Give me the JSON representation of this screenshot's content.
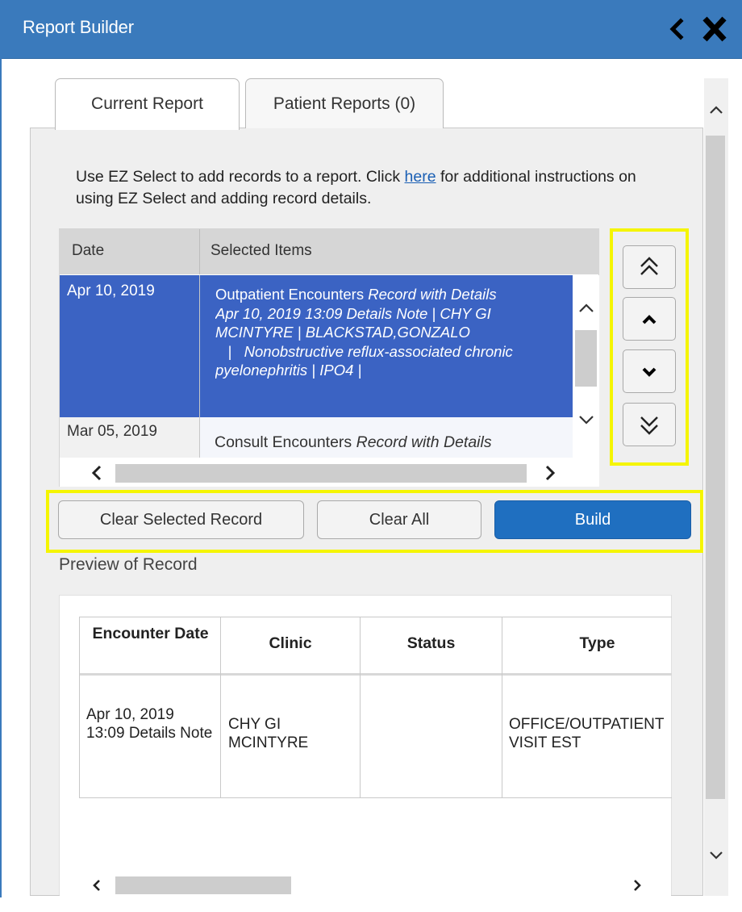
{
  "window": {
    "title": "Report Builder",
    "collapse_icon": "chevron-left-icon",
    "close_icon": "close-icon",
    "titlebar_color": "#3a7abc"
  },
  "tabs": [
    {
      "label": "Current Report",
      "selected": true
    },
    {
      "label": "Patient Reports (0)",
      "selected": false
    }
  ],
  "instructions": {
    "before_link": "Use EZ Select to add records to a report. Click ",
    "link_text": "here",
    "after_link": " for additional instructions on using EZ Select and adding record details."
  },
  "selected_items": {
    "headers": {
      "date": "Date",
      "items": "Selected Items"
    },
    "rows": [
      {
        "date": "Apr 10, 2019",
        "selected": true,
        "line1_plain": "Outpatient Encounters ",
        "line1_italic": "Record with Details",
        "line2": "Apr 10, 2019 13:09 Details Note   |   CHY GI",
        "line3": "MCINTYRE   |   BLACKSTAD,GONZALO",
        "line4": "   |   Nonobstructive reflux-associated chronic",
        "line5": "pyelonephritis   |   IPO4   |"
      },
      {
        "date": "Mar 05, 2019",
        "selected": false,
        "line1_plain": "Consult Encounters ",
        "line1_italic": "Record with Details"
      }
    ],
    "selected_color": "#3b63c3"
  },
  "reorder_buttons": [
    {
      "name": "move-to-top",
      "icon": "double-chevron-up-icon"
    },
    {
      "name": "move-up",
      "icon": "chevron-up-icon"
    },
    {
      "name": "move-down",
      "icon": "chevron-down-icon"
    },
    {
      "name": "move-to-bottom",
      "icon": "double-chevron-down-icon"
    }
  ],
  "actions": {
    "clear_selected": "Clear Selected Record",
    "clear_all": "Clear All",
    "build": "Build",
    "build_color": "#1f6fc0"
  },
  "preview": {
    "label": "Preview of Record",
    "headers": {
      "date": "Encounter Date",
      "clinic": "Clinic",
      "status": "Status",
      "type": "Type"
    },
    "row": {
      "date": "Apr 10, 2019 13:09 Details Note",
      "clinic": "CHY GI MCINTYRE",
      "status": "",
      "type": "OFFICE/OUTPATIENT VISIT EST"
    }
  },
  "highlight_color": "#f5f500"
}
